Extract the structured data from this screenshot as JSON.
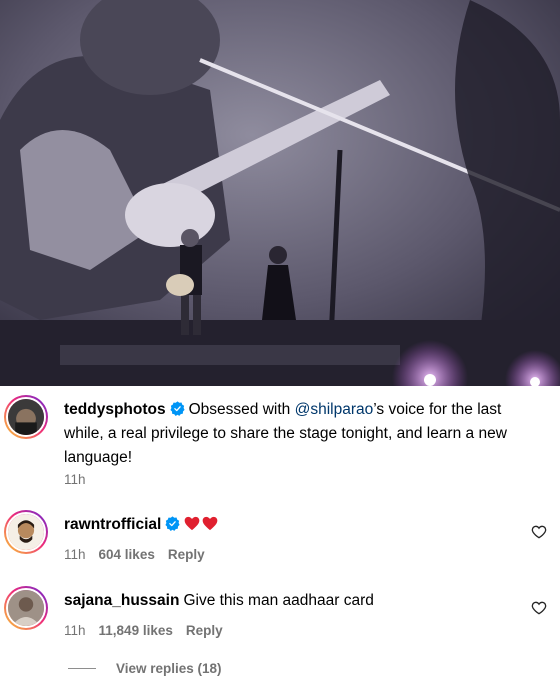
{
  "post": {
    "image_alt": "Concert photo: performer with acoustic guitar and singer on stage"
  },
  "caption": {
    "username": "teddysphotos",
    "verified": true,
    "text_before": "Obsessed with ",
    "mention": "@shilparao",
    "text_after": "’s voice for the last while, a real privilege to share the stage tonight, and learn a new language!",
    "time": "11h"
  },
  "comments": [
    {
      "username": "rawntrofficial",
      "verified": true,
      "emoji": [
        "red-heart",
        "red-heart"
      ],
      "time": "11h",
      "likes": "604 likes",
      "reply": "Reply"
    },
    {
      "username": "sajana_hussain",
      "verified": false,
      "text": "Give this man aadhaar card",
      "time": "11h",
      "likes": "11,849 likes",
      "reply": "Reply"
    }
  ],
  "view_replies": "View replies (18)"
}
